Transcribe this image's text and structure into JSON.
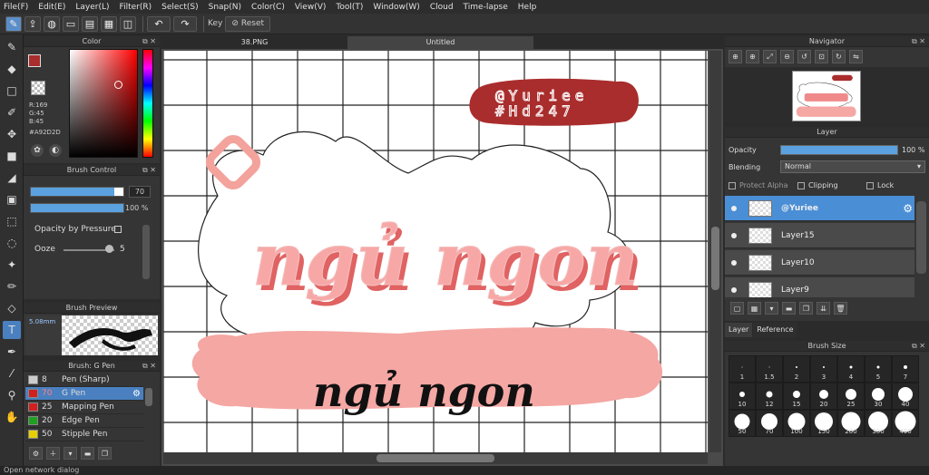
{
  "menu": [
    "File(F)",
    "Edit(E)",
    "Layer(L)",
    "Filter(R)",
    "Select(S)",
    "Snap(N)",
    "Color(C)",
    "View(V)",
    "Tool(T)",
    "Window(W)",
    "Cloud",
    "Time-lapse",
    "Help"
  ],
  "toolbar": {
    "key_label": "Key",
    "reset_label": "Reset"
  },
  "color_panel": {
    "title": "Color",
    "r": "R:169",
    "g": "G:45",
    "b": "B:45",
    "hex": "#A92D2D",
    "main_color": "#a92d2d"
  },
  "brush_control": {
    "title": "Brush Control",
    "size_value": "70",
    "opacity_value": "100 %",
    "opacity_by_pressure": "Opacity by Pressure",
    "ooze_label": "Ooze",
    "ooze_value": "5",
    "size_fraction": 0.9,
    "opacity_fraction": 1.0
  },
  "brush_preview": {
    "title": "Brush Preview",
    "size": "5.08mm"
  },
  "brush_list": {
    "title": "Brush: G Pen",
    "items": [
      {
        "num": "8",
        "name": "Pen (Sharp)",
        "color": "#cccccc"
      },
      {
        "num": "70",
        "name": "G Pen",
        "color": "#d02020",
        "active": true
      },
      {
        "num": "25",
        "name": "Mapping Pen",
        "color": "#d02020"
      },
      {
        "num": "20",
        "name": "Edge Pen",
        "color": "#20a020"
      },
      {
        "num": "50",
        "name": "Stipple Pen",
        "color": "#e8d000"
      }
    ]
  },
  "tabs": {
    "tab1": "38.PNG",
    "tab2": "Untitled"
  },
  "artwork": {
    "badge_line1": "@Yuriee",
    "badge_line2": "#Hd247",
    "main_text": "ngủ ngon",
    "sub_text": "ngủ ngon"
  },
  "navigator": {
    "title": "Navigator"
  },
  "layer_panel": {
    "title": "Layer",
    "opacity_label": "Opacity",
    "opacity_value": "100 %",
    "blending_label": "Blending",
    "blending_value": "Normal",
    "protect_alpha": "Protect Alpha",
    "clipping": "Clipping",
    "lock": "Lock",
    "layers": [
      {
        "name": "@Yuriee",
        "active": true
      },
      {
        "name": "Layer15"
      },
      {
        "name": "Layer10"
      },
      {
        "name": "Layer9"
      }
    ]
  },
  "panel_tabs": {
    "layer": "Layer",
    "reference": "Reference"
  },
  "brush_size": {
    "title": "Brush Size",
    "sizes": [
      {
        "label": "1",
        "d": 1
      },
      {
        "label": "1.5",
        "d": 1
      },
      {
        "label": "2",
        "d": 2
      },
      {
        "label": "3",
        "d": 2
      },
      {
        "label": "4",
        "d": 3
      },
      {
        "label": "5",
        "d": 3
      },
      {
        "label": "7",
        "d": 4
      },
      {
        "label": "10",
        "d": 6
      },
      {
        "label": "12",
        "d": 7
      },
      {
        "label": "15",
        "d": 8
      },
      {
        "label": "20",
        "d": 10
      },
      {
        "label": "25",
        "d": 12
      },
      {
        "label": "30",
        "d": 14
      },
      {
        "label": "40",
        "d": 16
      },
      {
        "label": "50",
        "d": 17
      },
      {
        "label": "70",
        "d": 18
      },
      {
        "label": "100",
        "d": 19
      },
      {
        "label": "150",
        "d": 20
      },
      {
        "label": "200",
        "d": 21
      },
      {
        "label": "300",
        "d": 22
      },
      {
        "label": "400",
        "d": 23
      }
    ]
  },
  "status": "Open network dialog"
}
